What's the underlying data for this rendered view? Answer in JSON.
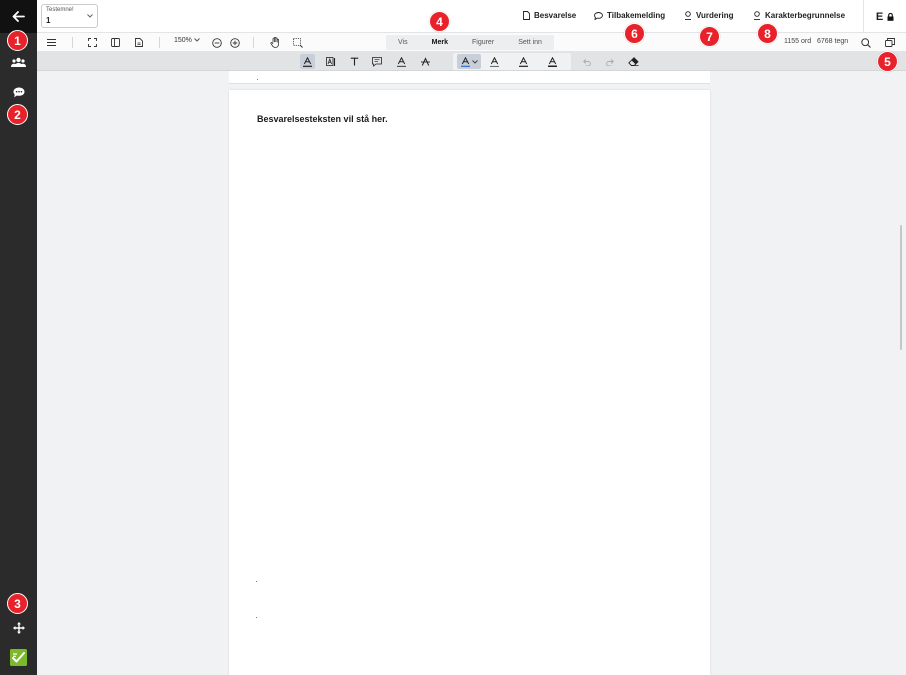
{
  "header": {
    "task_label": "Testemne!",
    "task_value": "1",
    "tabs": [
      {
        "label": "Besvarelse",
        "icon": "document-icon"
      },
      {
        "label": "Tilbakemelding",
        "icon": "comment-icon"
      },
      {
        "label": "Vurdering",
        "icon": "rubric-icon"
      },
      {
        "label": "Karakterbegrunnelse",
        "icon": "rubric-icon"
      }
    ],
    "grade": "E"
  },
  "toolbar": {
    "zoom": "150%",
    "modes": [
      "Vis",
      "Merk",
      "Figurer",
      "Sett inn"
    ],
    "active_mode": "Merk",
    "word_count": "1155",
    "word_unit": "ord",
    "char_count": "6768",
    "char_unit": "tegn"
  },
  "format_toolbar": {
    "tools": [
      "highlight-text",
      "highlight-area",
      "text",
      "comment",
      "underline",
      "strikethrough",
      "color-a",
      "color-b",
      "color-c",
      "color-d",
      "undo",
      "redo",
      "eraser"
    ]
  },
  "document": {
    "text": "Besvarelsesteksten vil stå her."
  },
  "callouts": [
    "1",
    "2",
    "3",
    "4",
    "5",
    "6",
    "7",
    "8"
  ],
  "colors": {
    "rail": "#2b2b2b",
    "badge": "#e8222a",
    "logo": "#7ab929"
  }
}
